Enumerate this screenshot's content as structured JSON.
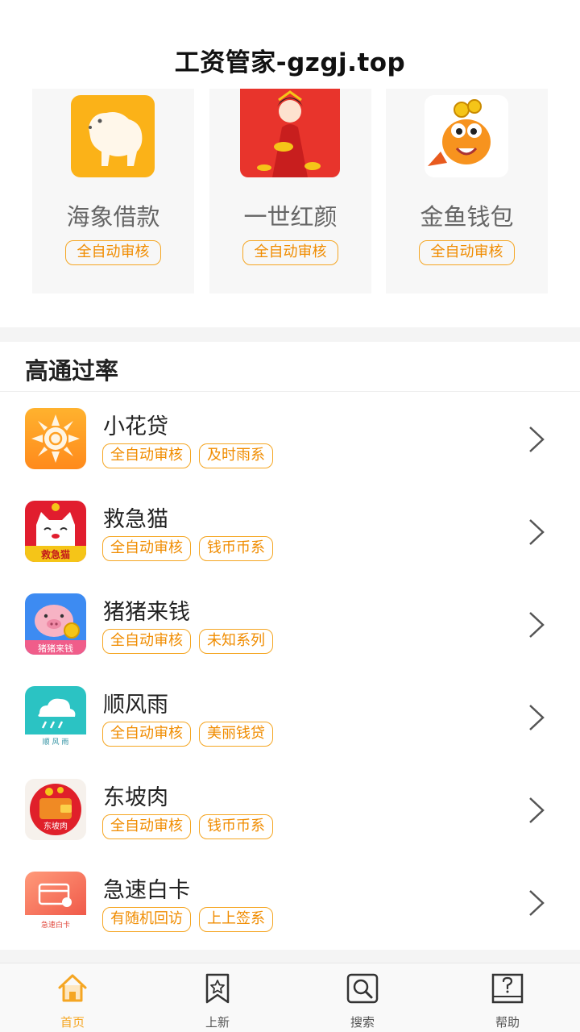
{
  "header": {
    "title": "工资管家-gzgj.top"
  },
  "featured": [
    {
      "name": "海象借款",
      "tag": "全自动审核",
      "icon": "polar-bear-logo"
    },
    {
      "name": "一世红颜",
      "tag": "全自动审核",
      "icon": "fortune-lady-logo"
    },
    {
      "name": "金鱼钱包",
      "tag": "全自动审核",
      "icon": "goldfish-logo"
    }
  ],
  "section": {
    "title": "高通过率"
  },
  "list": [
    {
      "name": "小花贷",
      "tags": [
        "全自动审核",
        "及时雨系"
      ],
      "icon": "sun-flower-logo"
    },
    {
      "name": "救急猫",
      "tags": [
        "全自动审核",
        "钱币币系"
      ],
      "icon": "lucky-cat-logo",
      "icon_text": "救急猫"
    },
    {
      "name": "猪猪来钱",
      "tags": [
        "全自动审核",
        "未知系列"
      ],
      "icon": "piggy-logo",
      "icon_text": "猪猪来钱"
    },
    {
      "name": "顺风雨",
      "tags": [
        "全自动审核",
        "美丽钱贷"
      ],
      "icon": "rain-cloud-logo",
      "icon_text": "顺 风 雨"
    },
    {
      "name": "东坡肉",
      "tags": [
        "全自动审核",
        "钱币币系"
      ],
      "icon": "wallet-logo",
      "icon_text": "东坡肉"
    },
    {
      "name": "急速白卡",
      "tags": [
        "有随机回访",
        "上上签系"
      ],
      "icon": "card-logo",
      "icon_text": "急速白卡"
    }
  ],
  "tabs": [
    {
      "label": "首页",
      "icon": "home-icon",
      "active": true
    },
    {
      "label": "上新",
      "icon": "bookmark-star-icon",
      "active": false
    },
    {
      "label": "搜索",
      "icon": "search-icon",
      "active": false
    },
    {
      "label": "帮助",
      "icon": "help-icon",
      "active": false
    }
  ],
  "colors": {
    "accent": "#f5a623",
    "tag_text": "#f08c00",
    "background_gray": "#f4f4f4"
  }
}
